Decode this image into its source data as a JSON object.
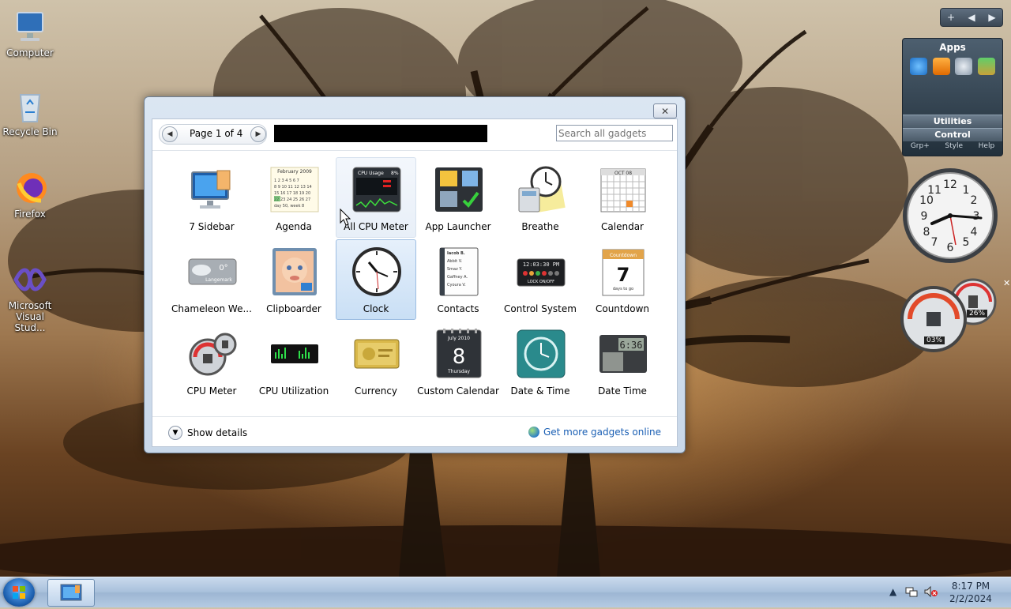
{
  "desktop": {
    "icons": [
      {
        "label": "Computer"
      },
      {
        "label": "Recycle Bin"
      },
      {
        "label": "Firefox"
      },
      {
        "label": "Microsoft Visual Stud..."
      }
    ]
  },
  "gallery": {
    "close_glyph": "✕",
    "pager": {
      "label": "Page 1 of 4",
      "prev_glyph": "◀",
      "next_glyph": "▶"
    },
    "search": {
      "placeholder": "Search all gadgets",
      "value": "Search all gadgets"
    },
    "gadgets": [
      {
        "label": "7 Sidebar",
        "icon": "monitor-icon"
      },
      {
        "label": "Agenda",
        "icon": "agenda-calendar-icon"
      },
      {
        "label": "All CPU Meter",
        "icon": "cpu-usage-icon"
      },
      {
        "label": "App Launcher",
        "icon": "app-launcher-icon"
      },
      {
        "label": "Breathe",
        "icon": "breathe-clock-icon"
      },
      {
        "label": "Calendar",
        "icon": "calendar-icon"
      },
      {
        "label": "Chameleon We...",
        "icon": "weather-icon"
      },
      {
        "label": "Clipboarder",
        "icon": "clipboarder-icon"
      },
      {
        "label": "Clock",
        "icon": "clock-icon"
      },
      {
        "label": "Contacts",
        "icon": "contacts-icon"
      },
      {
        "label": "Control System",
        "icon": "control-system-icon"
      },
      {
        "label": "Countdown",
        "icon": "countdown-icon"
      },
      {
        "label": "CPU Meter",
        "icon": "cpu-meter-icon"
      },
      {
        "label": "CPU Utilization",
        "icon": "cpu-utilization-icon"
      },
      {
        "label": "Currency",
        "icon": "currency-icon"
      },
      {
        "label": "Custom Calendar",
        "icon": "custom-calendar-icon"
      },
      {
        "label": "Date & Time",
        "icon": "date-time-clock-icon"
      },
      {
        "label": "Date Time",
        "icon": "date-time-digital-icon"
      }
    ],
    "tile_text": {
      "agenda_month": "February 2009",
      "cpu_usage": "CPU Usage",
      "cpu_pct": "8%",
      "calendar_month": "OCT 08",
      "weather_temp": "0°",
      "weather_place": "Langemark",
      "control_time": "12:03:30 PM",
      "lock_label": "LOCK ON/OFF",
      "countdown_title": "Countdown",
      "countdown_num": "7",
      "countdown_sub": "days to go",
      "custom_cal_month": "July 2010",
      "custom_cal_num": "8",
      "custom_cal_day": "Thursday",
      "datetime_digits": "6:36",
      "contacts": [
        "Iacob B.",
        "Abbit V.",
        "Smaz Y.",
        "Gaffney A.",
        "Cyoura V."
      ]
    },
    "details_label": "Show details",
    "online_label": "Get more gadgets online"
  },
  "sidebar": {
    "controls": [
      "+",
      "◀",
      "▶"
    ],
    "apps": {
      "title": "Apps",
      "rows": [
        "Utilities",
        "Control"
      ],
      "mini": [
        "Grp+",
        "Style",
        "Help"
      ]
    },
    "meter": {
      "cpu": "03%",
      "mem": "26%"
    },
    "close_glyph": "✕"
  },
  "taskbar": {
    "time": "8:17 PM",
    "date": "2/2/2024",
    "tray_up": "▲"
  }
}
